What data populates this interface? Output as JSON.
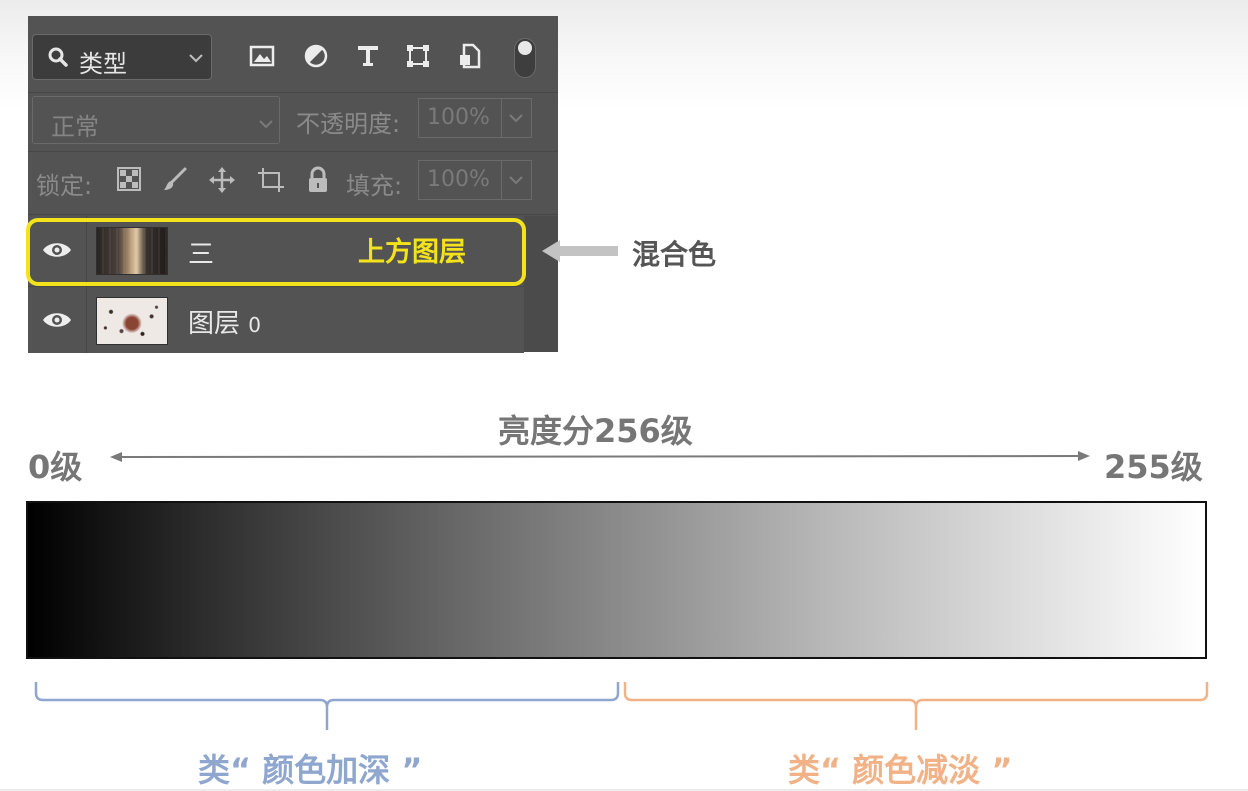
{
  "layers_panel": {
    "filter": {
      "label": "类型",
      "icons": [
        "image-filter-icon",
        "adjustment-filter-icon",
        "type-filter-icon",
        "shape-filter-icon",
        "smart-object-filter-icon"
      ]
    },
    "blend_mode": "正常",
    "opacity": {
      "label": "不透明度:",
      "value": "100%"
    },
    "lock": {
      "label": "锁定:",
      "icons": [
        "lock-transparent-icon",
        "lock-paint-icon",
        "lock-position-icon",
        "lock-artboard-icon",
        "lock-all-icon"
      ]
    },
    "fill": {
      "label": "填充:",
      "value": "100%"
    },
    "layers": [
      {
        "name": "三",
        "selected": true
      },
      {
        "name": "图层",
        "suffix": "0",
        "selected": false
      }
    ]
  },
  "annotations": {
    "upper_layer": "上方图层",
    "blend_color": "混合色",
    "brightness_title": "亮度分256级",
    "level_min": "0级",
    "level_max": "255级",
    "left_group": "类“ 颜色加深 ”",
    "right_group": "类“ 颜色减淡 ”",
    "colors": {
      "highlight": "#f4e31b",
      "left_group": "#8fa6cf",
      "right_group": "#f2b287",
      "annotation_gray": "#767676"
    }
  }
}
